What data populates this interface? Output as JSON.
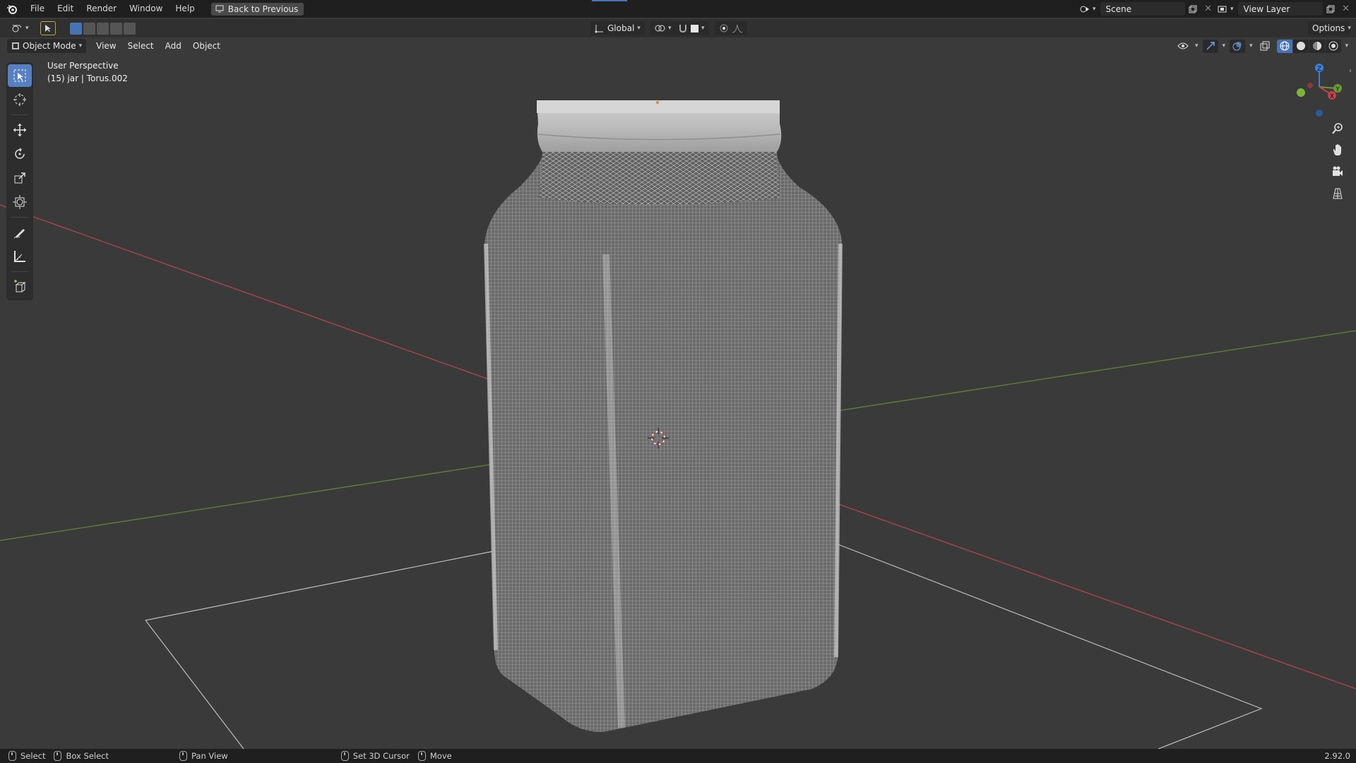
{
  "menubar": {
    "items": [
      "File",
      "Edit",
      "Render",
      "Window",
      "Help"
    ],
    "back_button": "Back to Previous",
    "scene": "Scene",
    "view_layer": "View Layer"
  },
  "header": {
    "orientation": "Global",
    "options": "Options"
  },
  "viewport_header": {
    "mode": "Object Mode",
    "menus": [
      "View",
      "Select",
      "Add",
      "Object"
    ]
  },
  "overlay": {
    "view_name": "User Perspective",
    "object_info": "(15) jar | Torus.002"
  },
  "gizmo": {
    "z_label": "Z",
    "y_label": "Y",
    "x_label": "X"
  },
  "statusbar": {
    "select": "Select",
    "box_select": "Box Select",
    "pan_view": "Pan View",
    "set_cursor": "Set 3D Cursor",
    "move": "Move",
    "version": "2.92.0"
  },
  "colors": {
    "active_tool": "#5680c2",
    "x_axis": "#c4414a",
    "y_axis": "#6a9a2d",
    "z_axis": "#3a7fd8"
  }
}
